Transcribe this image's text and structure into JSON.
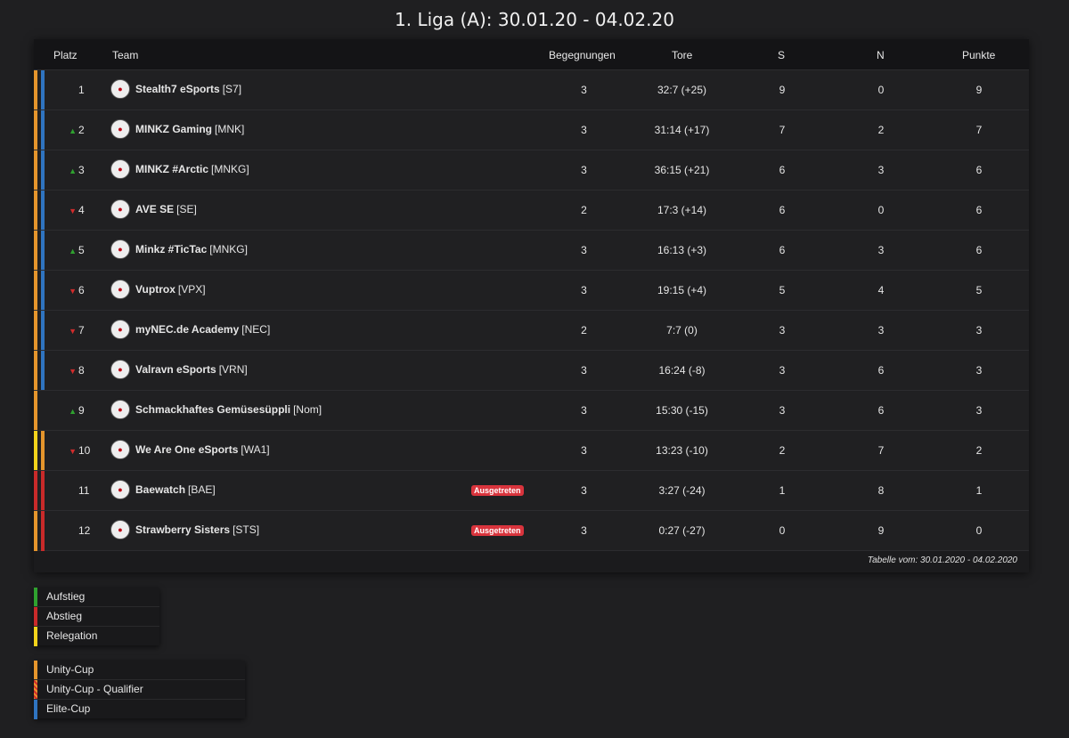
{
  "title": "1. Liga (A): 30.01.20 - 04.02.20",
  "columns": {
    "place": "Platz",
    "team": "Team",
    "matches": "Begegnungen",
    "goals": "Tore",
    "wins": "S",
    "losses": "N",
    "points": "Punkte"
  },
  "colors": {
    "unity_cup": "#e5952c",
    "elite_cup": "#2f74c0",
    "aufstieg": "#2fa12f",
    "abstieg": "#c92a2a",
    "relegation": "#f2d31b",
    "badge": "#d9343d"
  },
  "rows": [
    {
      "place": "1",
      "trend": "",
      "team": "Stealth7 eSports",
      "tag": "[S7]",
      "matches": "3",
      "goals": "32:7 (+25)",
      "wins": "9",
      "losses": "0",
      "points": "9",
      "badge": "",
      "bar1": "unity",
      "bar2": "elite"
    },
    {
      "place": "2",
      "trend": "up",
      "team": "MINKZ Gaming",
      "tag": "[MNK]",
      "matches": "3",
      "goals": "31:14 (+17)",
      "wins": "7",
      "losses": "2",
      "points": "7",
      "badge": "",
      "bar1": "unity",
      "bar2": "elite"
    },
    {
      "place": "3",
      "trend": "up",
      "team": "MINKZ #Arctic",
      "tag": "[MNKG]",
      "matches": "3",
      "goals": "36:15 (+21)",
      "wins": "6",
      "losses": "3",
      "points": "6",
      "badge": "",
      "bar1": "unity",
      "bar2": "elite"
    },
    {
      "place": "4",
      "trend": "down",
      "team": "AVE SE",
      "tag": "[SE]",
      "matches": "2",
      "goals": "17:3 (+14)",
      "wins": "6",
      "losses": "0",
      "points": "6",
      "badge": "",
      "bar1": "unity",
      "bar2": "elite"
    },
    {
      "place": "5",
      "trend": "up",
      "team": "Minkz #TicTac",
      "tag": "[MNKG]",
      "matches": "3",
      "goals": "16:13 (+3)",
      "wins": "6",
      "losses": "3",
      "points": "6",
      "badge": "",
      "bar1": "unity",
      "bar2": "elite"
    },
    {
      "place": "6",
      "trend": "down",
      "team": "Vuptrox",
      "tag": "[VPX]",
      "matches": "3",
      "goals": "19:15 (+4)",
      "wins": "5",
      "losses": "4",
      "points": "5",
      "badge": "",
      "bar1": "unity",
      "bar2": "elite"
    },
    {
      "place": "7",
      "trend": "down",
      "team": "myNEC.de Academy",
      "tag": "[NEC]",
      "matches": "2",
      "goals": "7:7 (0)",
      "wins": "3",
      "losses": "3",
      "points": "3",
      "badge": "",
      "bar1": "unity",
      "bar2": "elite"
    },
    {
      "place": "8",
      "trend": "down",
      "team": "Valravn eSports",
      "tag": "[VRN]",
      "matches": "3",
      "goals": "16:24 (-8)",
      "wins": "3",
      "losses": "6",
      "points": "3",
      "badge": "",
      "bar1": "unity",
      "bar2": "elite"
    },
    {
      "place": "9",
      "trend": "up",
      "team": "Schmackhaftes Gemüsesüppli",
      "tag": "[Nom]",
      "matches": "3",
      "goals": "15:30 (-15)",
      "wins": "3",
      "losses": "6",
      "points": "3",
      "badge": "",
      "bar1": "unity",
      "bar2": ""
    },
    {
      "place": "10",
      "trend": "down",
      "team": "We Are One eSports",
      "tag": "[WA1]",
      "matches": "3",
      "goals": "13:23 (-10)",
      "wins": "2",
      "losses": "7",
      "points": "2",
      "badge": "",
      "bar1": "relegation",
      "bar2": "unity"
    },
    {
      "place": "11",
      "trend": "",
      "team": "Baewatch",
      "tag": "[BAE]",
      "matches": "3",
      "goals": "3:27 (-24)",
      "wins": "1",
      "losses": "8",
      "points": "1",
      "badge": "Ausgetreten",
      "bar1": "abstieg",
      "bar2": "abstieg"
    },
    {
      "place": "12",
      "trend": "",
      "team": "Strawberry Sisters",
      "tag": "[STS]",
      "matches": "3",
      "goals": "0:27 (-27)",
      "wins": "0",
      "losses": "9",
      "points": "0",
      "badge": "Ausgetreten",
      "bar1": "unity",
      "bar2": "abstieg"
    }
  ],
  "footer": "Tabelle vom: 30.01.2020 - 04.02.2020",
  "legend1": [
    {
      "label": "Aufstieg",
      "color": "aufstieg"
    },
    {
      "label": "Abstieg",
      "color": "abstieg"
    },
    {
      "label": "Relegation",
      "color": "relegation"
    }
  ],
  "legend2": [
    {
      "label": "Unity-Cup",
      "color": "unity_cup"
    },
    {
      "label": "Unity-Cup - Qualifier",
      "color": "hatch"
    },
    {
      "label": "Elite-Cup",
      "color": "elite_cup"
    }
  ]
}
